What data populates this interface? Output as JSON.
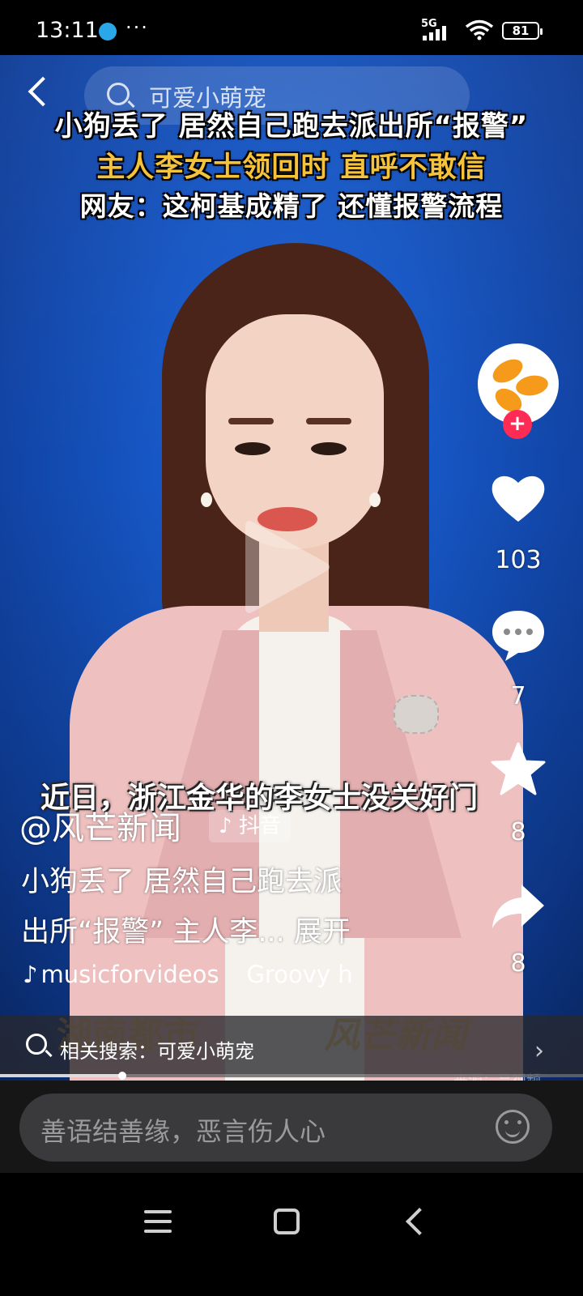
{
  "status_bar": {
    "time": "13:11",
    "more": "···",
    "network": "5G",
    "battery": "81"
  },
  "top_search": {
    "query": "可爱小萌宠"
  },
  "video": {
    "headline_1": "小狗丢了 居然自己跑去派出所“报警”",
    "headline_2": "主人李女士领回时 直呼不敢信",
    "headline_3": "网友：这柯基成精了 还懂报警流程",
    "subtitle": "近日，浙江金华的李女士没关好门",
    "watermark_left": "湖南都市",
    "watermark_right": "风芒新闻",
    "source": "来源：吕视频",
    "progress_fraction": 0.21
  },
  "right_rail": {
    "likes": "103",
    "comments": "7",
    "favorites": "8",
    "shares": "8",
    "follow_label": "+"
  },
  "post": {
    "author": "@风芒新闻",
    "platform_tag": "抖音",
    "description_line_1": "小狗丢了 居然自己跑去派",
    "description_line_2": "出所“报警” 主人李... 展开",
    "music_account": "musicforvideos",
    "music_track": "Groovy h"
  },
  "related_search": {
    "text": "相关搜索：可爱小萌宠"
  },
  "comment_bar": {
    "placeholder": "善语结善缘，恶言伤人心"
  },
  "colors": {
    "accent_red": "#fe2c55",
    "headline_yellow": "#f5c33b",
    "avatar_orange": "#f59a1b"
  }
}
